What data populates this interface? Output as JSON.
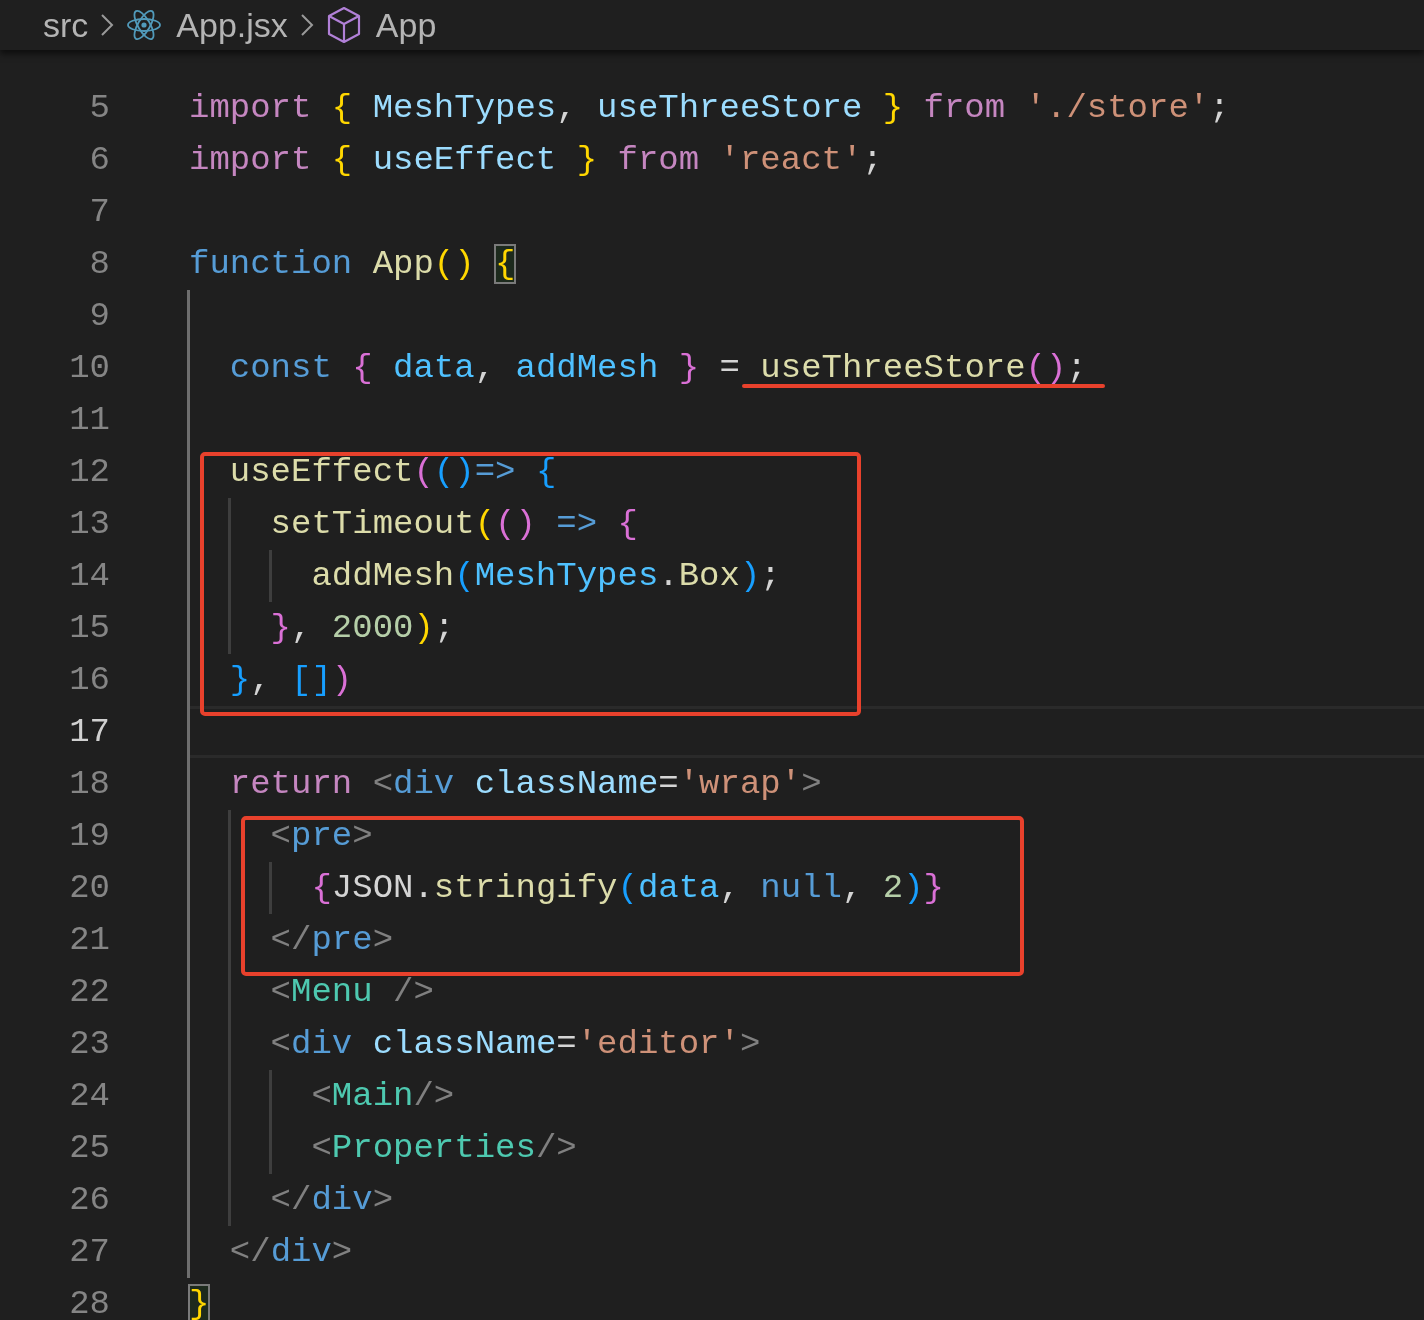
{
  "breadcrumb": [
    {
      "kind": "folder",
      "label": "src"
    },
    {
      "kind": "react-file",
      "label": "App.jsx"
    },
    {
      "kind": "symbol",
      "label": "App"
    }
  ],
  "code": {
    "blocks": [
      {
        "kind": "plain",
        "lines": [
          {
            "number": "5",
            "current": false,
            "tokens": [
              {
                "kind": "kw",
                "text": "import "
              },
              {
                "kind": "b1",
                "text": "{ "
              },
              {
                "kind": "var",
                "text": "MeshTypes"
              },
              {
                "kind": "punct",
                "text": ", "
              },
              {
                "kind": "var",
                "text": "useThreeStore"
              },
              {
                "kind": "b1",
                "text": " } "
              },
              {
                "kind": "kw",
                "text": "from "
              },
              {
                "kind": "str",
                "text": "'./store'"
              },
              {
                "kind": "punct",
                "text": ";"
              }
            ]
          },
          {
            "number": "6",
            "current": false,
            "tokens": [
              {
                "kind": "kw",
                "text": "import "
              },
              {
                "kind": "b1",
                "text": "{ "
              },
              {
                "kind": "var",
                "text": "useEffect"
              },
              {
                "kind": "b1",
                "text": " } "
              },
              {
                "kind": "kw",
                "text": "from "
              },
              {
                "kind": "str",
                "text": "'react'"
              },
              {
                "kind": "punct",
                "text": ";"
              }
            ]
          },
          {
            "number": "7",
            "current": false
          },
          {
            "number": "8",
            "current": false,
            "tokens": [
              {
                "kind": "storage",
                "text": "function "
              },
              {
                "kind": "fn",
                "text": "App"
              },
              {
                "kind": "b1",
                "text": "() "
              },
              {
                "kind": "brace-match",
                "text": "{"
              }
            ]
          },
          {
            "number": "9",
            "current": false
          },
          {
            "number": "10",
            "current": false,
            "tokens": [
              {
                "kind": "storage",
                "text": "  const ",
                "underlined": false
              },
              {
                "kind": "b2",
                "text": "{ ",
                "underlined": false
              },
              {
                "kind": "const",
                "text": "data",
                "underlined": false
              },
              {
                "kind": "punct",
                "text": ", ",
                "underlined": false
              },
              {
                "kind": "const",
                "text": "addMesh",
                "underlined": false
              },
              {
                "kind": "b2",
                "text": " } ",
                "underlined": false
              },
              {
                "kind": "punct",
                "text": "= ",
                "underlined": false
              },
              {
                "kind": "fn",
                "text": "useThreeStore",
                "underlined": true
              },
              {
                "kind": "b2",
                "text": "()",
                "underlined": true
              },
              {
                "kind": "punct",
                "text": ";",
                "underlined": true
              }
            ]
          },
          {
            "number": "11",
            "current": false
          }
        ]
      },
      {
        "kind": "boxed",
        "lines": [
          {
            "number": "12",
            "current": false,
            "tokens": [
              {
                "kind": "fn",
                "text": "  useEffect"
              },
              {
                "kind": "b2",
                "text": "("
              },
              {
                "kind": "b3",
                "text": "()"
              },
              {
                "kind": "storage",
                "text": "=> "
              },
              {
                "kind": "b3",
                "text": "{"
              }
            ]
          },
          {
            "number": "13",
            "current": false,
            "tokens": [
              {
                "kind": "fn",
                "text": "    setTimeout"
              },
              {
                "kind": "b1",
                "text": "("
              },
              {
                "kind": "b2",
                "text": "() "
              },
              {
                "kind": "storage",
                "text": "=> "
              },
              {
                "kind": "b2",
                "text": "{"
              }
            ]
          },
          {
            "number": "14",
            "current": false,
            "tokens": [
              {
                "kind": "fn",
                "text": "      addMesh"
              },
              {
                "kind": "b3",
                "text": "("
              },
              {
                "kind": "const",
                "text": "MeshTypes"
              },
              {
                "kind": "punct",
                "text": "."
              },
              {
                "kind": "fn",
                "text": "Box"
              },
              {
                "kind": "b3",
                "text": ")"
              },
              {
                "kind": "punct",
                "text": ";"
              }
            ]
          },
          {
            "number": "15",
            "current": false,
            "tokens": [
              {
                "kind": "b2",
                "text": "    }"
              },
              {
                "kind": "punct",
                "text": ", "
              },
              {
                "kind": "num",
                "text": "2000"
              },
              {
                "kind": "b1",
                "text": ")"
              },
              {
                "kind": "punct",
                "text": ";"
              }
            ]
          },
          {
            "number": "16",
            "current": false,
            "tokens": [
              {
                "kind": "b3",
                "text": "  }"
              },
              {
                "kind": "punct",
                "text": ", "
              },
              {
                "kind": "b3",
                "text": "[]"
              },
              {
                "kind": "b2",
                "text": ")"
              }
            ]
          }
        ]
      },
      {
        "kind": "plain",
        "lines": [
          {
            "number": "17",
            "current": true
          },
          {
            "number": "18",
            "current": false,
            "tokens": [
              {
                "kind": "kw",
                "text": "  return "
              },
              {
                "kind": "angle",
                "text": "<"
              },
              {
                "kind": "tag",
                "text": "div"
              },
              {
                "kind": "attr",
                "text": " className"
              },
              {
                "kind": "punct",
                "text": "="
              },
              {
                "kind": "str",
                "text": "'wrap'"
              },
              {
                "kind": "angle",
                "text": ">"
              }
            ]
          }
        ]
      },
      {
        "kind": "boxed",
        "lines": [
          {
            "number": "19",
            "current": false,
            "tokens": [
              {
                "kind": "angle",
                "text": "    <"
              },
              {
                "kind": "tag",
                "text": "pre"
              },
              {
                "kind": "angle",
                "text": ">"
              }
            ]
          },
          {
            "number": "20",
            "current": false,
            "tokens": [
              {
                "kind": "b2",
                "text": "      {"
              },
              {
                "kind": "plain",
                "text": "JSON"
              },
              {
                "kind": "punct",
                "text": "."
              },
              {
                "kind": "fn",
                "text": "stringify"
              },
              {
                "kind": "b3",
                "text": "("
              },
              {
                "kind": "const",
                "text": "data"
              },
              {
                "kind": "punct",
                "text": ", "
              },
              {
                "kind": "storage",
                "text": "null"
              },
              {
                "kind": "punct",
                "text": ", "
              },
              {
                "kind": "num",
                "text": "2"
              },
              {
                "kind": "b3",
                "text": ")"
              },
              {
                "kind": "b2",
                "text": "}"
              }
            ]
          },
          {
            "number": "21",
            "current": false,
            "tokens": [
              {
                "kind": "angle",
                "text": "    </"
              },
              {
                "kind": "tag",
                "text": "pre"
              },
              {
                "kind": "angle",
                "text": ">"
              }
            ]
          }
        ]
      },
      {
        "kind": "plain",
        "lines": [
          {
            "number": "22",
            "current": false,
            "tokens": [
              {
                "kind": "angle",
                "text": "    <"
              },
              {
                "kind": "comp",
                "text": "Menu"
              },
              {
                "kind": "angle",
                "text": " />"
              }
            ]
          },
          {
            "number": "23",
            "current": false,
            "tokens": [
              {
                "kind": "angle",
                "text": "    <"
              },
              {
                "kind": "tag",
                "text": "div"
              },
              {
                "kind": "attr",
                "text": " className"
              },
              {
                "kind": "punct",
                "text": "="
              },
              {
                "kind": "str",
                "text": "'editor'"
              },
              {
                "kind": "angle",
                "text": ">"
              }
            ]
          },
          {
            "number": "24",
            "current": false,
            "tokens": [
              {
                "kind": "angle",
                "text": "      <"
              },
              {
                "kind": "comp",
                "text": "Main"
              },
              {
                "kind": "angle",
                "text": "/>"
              }
            ]
          },
          {
            "number": "25",
            "current": false,
            "tokens": [
              {
                "kind": "angle",
                "text": "      <"
              },
              {
                "kind": "comp",
                "text": "Properties"
              },
              {
                "kind": "angle",
                "text": "/>"
              }
            ]
          },
          {
            "number": "26",
            "current": false,
            "tokens": [
              {
                "kind": "angle",
                "text": "    </"
              },
              {
                "kind": "tag",
                "text": "div"
              },
              {
                "kind": "angle",
                "text": ">"
              }
            ]
          },
          {
            "number": "27",
            "current": false,
            "tokens": [
              {
                "kind": "angle",
                "text": "  </"
              },
              {
                "kind": "tag",
                "text": "div"
              },
              {
                "kind": "angle",
                "text": ">"
              }
            ]
          },
          {
            "number": "28",
            "current": false,
            "tokens": [
              {
                "kind": "brace-match",
                "text": "}"
              }
            ]
          }
        ]
      }
    ]
  }
}
